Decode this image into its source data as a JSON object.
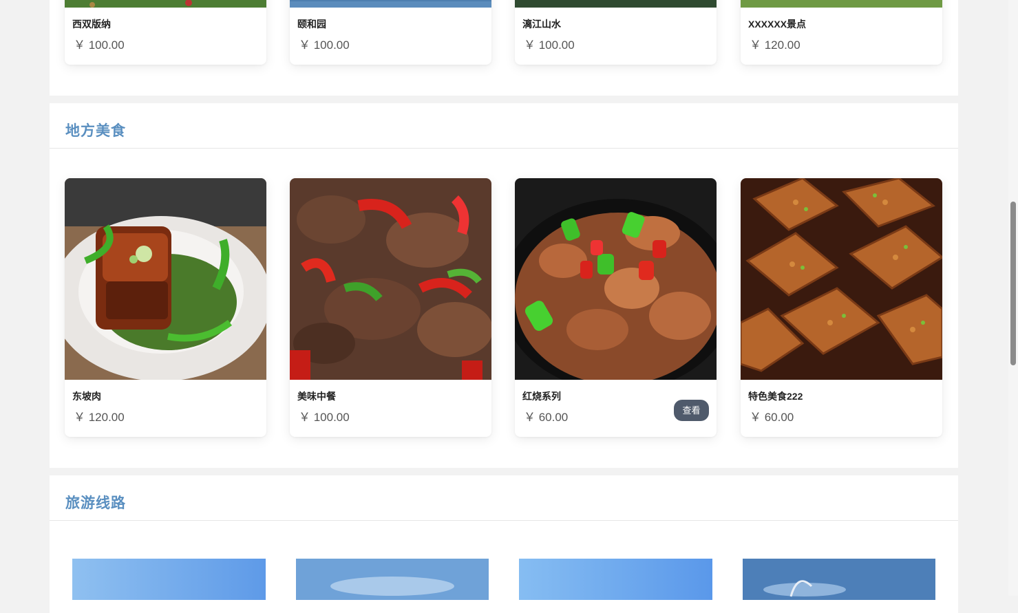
{
  "top_cards": [
    {
      "name": "西双版纳",
      "price": "￥ 100.00"
    },
    {
      "name": "颐和园",
      "price": "￥ 100.00"
    },
    {
      "name": "漓江山水",
      "price": "￥ 100.00"
    },
    {
      "name": "XXXXXX景点",
      "price": "￥ 120.00"
    }
  ],
  "food_section": {
    "title": "地方美食",
    "items": [
      {
        "name": "东坡肉",
        "price": "￥ 120.00"
      },
      {
        "name": "美味中餐",
        "price": "￥ 100.00"
      },
      {
        "name": "红烧系列",
        "price": "￥ 60.00",
        "button": "查看"
      },
      {
        "name": "特色美食222",
        "price": "￥ 60.00"
      }
    ]
  },
  "route_section": {
    "title": "旅游线路"
  }
}
